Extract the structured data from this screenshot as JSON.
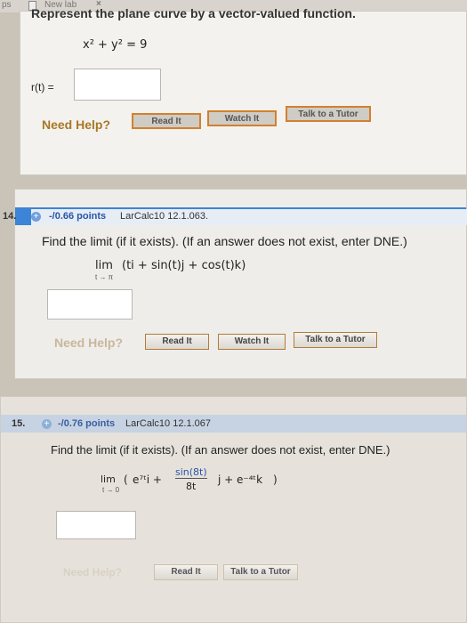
{
  "topbar": {
    "left_text": "ps",
    "tab_label": "New lab",
    "tab_close": "×"
  },
  "q13": {
    "question": "Represent the plane curve by a vector-valued function.",
    "equation": "x² + y² = 9",
    "answer_label": "r(t) =",
    "answer_value": "",
    "need_help": "Need Help?",
    "buttons": [
      "Read It",
      "Watch It",
      "Talk to a Tutor"
    ]
  },
  "q14": {
    "number": "14.",
    "points": "-/0.66 points",
    "source": "LarCalc10 12.1.063.",
    "question": "Find the limit (if it exists). (If an answer does not exist, enter DNE.)",
    "limit_word": "lim",
    "limit_sub": "t → π",
    "expression": "(ti + sin(t)j + cos(t)k)",
    "answer_value": "",
    "need_help": "Need Help?",
    "buttons": [
      "Read It",
      "Watch It",
      "Talk to a Tutor"
    ]
  },
  "q15": {
    "number": "15.",
    "points": "-/0.76 points",
    "source": "LarCalc10 12.1.067",
    "question": "Find the limit (if it exists). (If an answer does not exist, enter DNE.)",
    "limit_word": "lim",
    "limit_sub": "t → 0",
    "term1": "e⁷ᵗi +",
    "fraction_num": "sin(8t)",
    "fraction_den": "8t",
    "term2": "j + e⁻⁴ᵗk",
    "answer_value": "",
    "need_help": "Need Help?",
    "buttons": [
      "Read It",
      "Talk to a Tutor"
    ]
  }
}
